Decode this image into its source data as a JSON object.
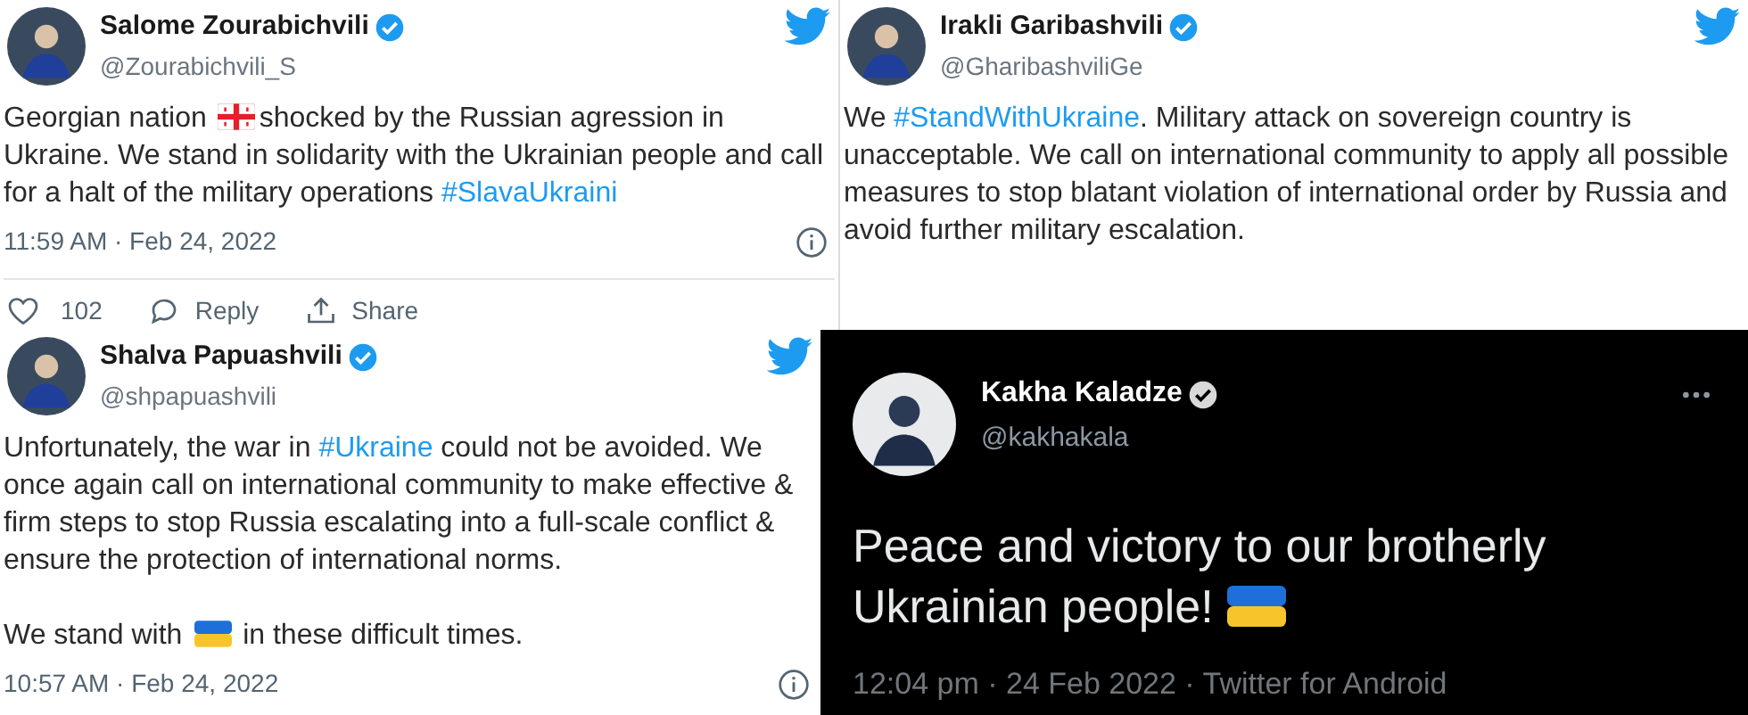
{
  "tweets": [
    {
      "kind": "light",
      "name": "Salome Zourabichvili",
      "handle": "@Zourabichvili_S",
      "verified": true,
      "bird": true,
      "more": false,
      "paragraphs": [
        [
          {
            "kind": "text",
            "text": "Georgian nation "
          },
          {
            "kind": "georgia-flag"
          },
          {
            "kind": "text",
            "text": "shocked by the Russian agression in Ukraine.  We stand in solidarity with the Ukrainian people and call for a halt of the military operations "
          },
          {
            "kind": "hashtag",
            "text": "#SlavaUkraini"
          }
        ]
      ],
      "timestamp": "11:59 AM · Feb 24, 2022",
      "actions": {
        "likes": "102",
        "reply": "Reply",
        "share": "Share"
      }
    },
    {
      "kind": "light",
      "name": "Irakli Garibashvili",
      "handle": "@GharibashviliGe",
      "verified": true,
      "bird": true,
      "more": false,
      "paragraphs": [
        [
          {
            "kind": "text",
            "text": "We "
          },
          {
            "kind": "hashtag",
            "text": "#StandWithUkraine"
          },
          {
            "kind": "text",
            "text": ". Military attack on sovereign country is unacceptable. We call on international community to apply all possible measures to stop blatant violation of international order by Russia and avoid further military escalation."
          }
        ]
      ]
    },
    {
      "kind": "light",
      "name": "Shalva Papuashvili",
      "handle": "@shpapuashvili",
      "verified": true,
      "bird": true,
      "more": false,
      "paragraphs": [
        [
          {
            "kind": "text",
            "text": "Unfortunately, the war in "
          },
          {
            "kind": "hashtag",
            "text": "#Ukraine"
          },
          {
            "kind": "text",
            "text": " could not be avoided. We once again call on international community to make effective & firm steps to stop Russia escalating into a full-scale conflict & ensure the protection of international norms."
          }
        ],
        [
          {
            "kind": "text",
            "text": "We stand with "
          },
          {
            "kind": "ukraine-flag"
          },
          {
            "kind": "text",
            "text": " in these difficult times."
          }
        ]
      ],
      "timestamp": "10:57 AM · Feb 24, 2022"
    },
    {
      "kind": "dark",
      "name": "Kakha Kaladze",
      "handle": "@kakhakala",
      "verified": true,
      "bird": false,
      "more": true,
      "paragraphs": [
        [
          {
            "kind": "text",
            "text": "Peace and victory to our brotherly Ukrainian people! "
          },
          {
            "kind": "ukraine-flag"
          }
        ]
      ],
      "timestamp": "12:04 pm · 24 Feb 2022 · Twitter for Android"
    }
  ]
}
